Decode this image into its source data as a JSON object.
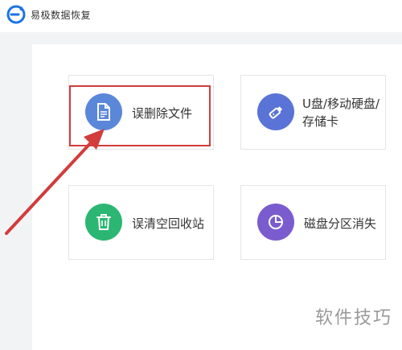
{
  "app": {
    "title": "易极数据恢复",
    "logo_icon": "recovery-logo-icon",
    "logo_color": "#1a73e8"
  },
  "cards": [
    {
      "label": "误删除文件",
      "icon": "document-icon",
      "color": "#5b87d9"
    },
    {
      "label": "U盘/移动硬盘/存储卡",
      "icon": "usb-drive-icon",
      "color": "#5a73d6"
    },
    {
      "label": "误清空回收站",
      "icon": "trash-icon",
      "color": "#2bb673"
    },
    {
      "label": "磁盘分区消失",
      "icon": "pie-chart-icon",
      "color": "#7a5ccf"
    }
  ],
  "annotation": {
    "highlight_color": "#d23c3c",
    "arrow_color": "#d23c3c"
  },
  "watermark": "软件技巧"
}
